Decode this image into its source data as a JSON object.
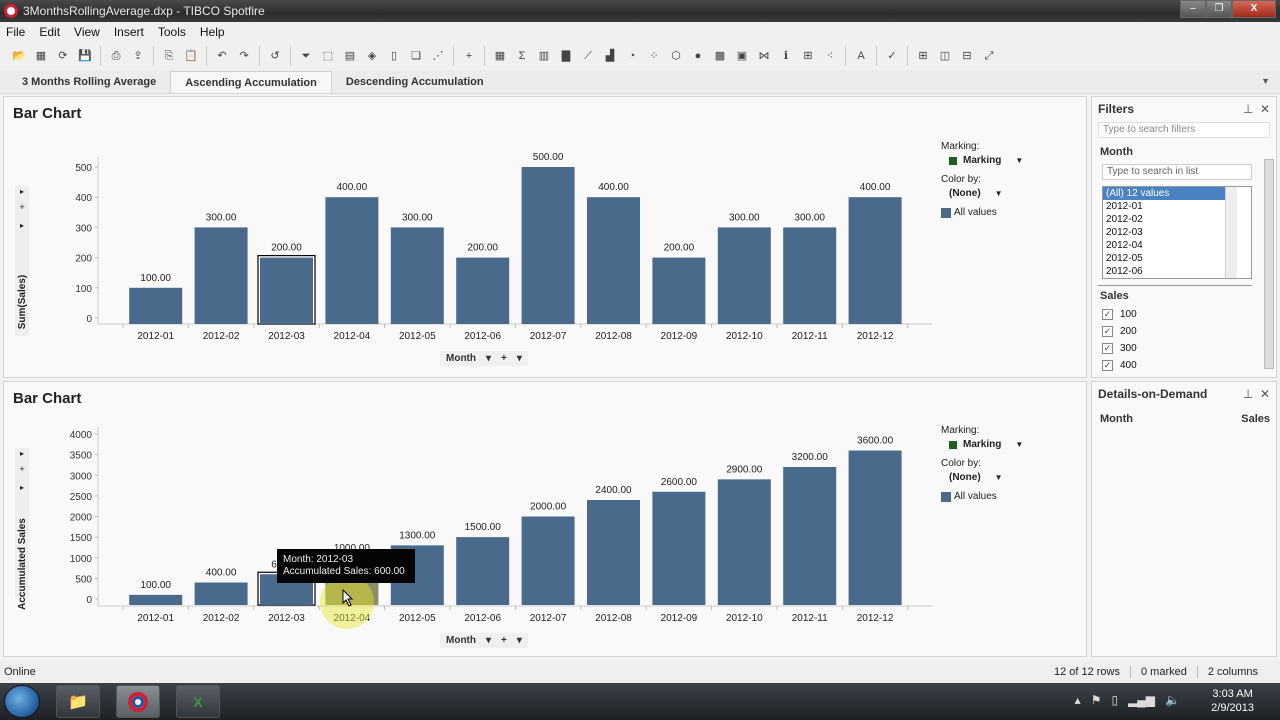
{
  "window": {
    "title": "3MonthsRollingAverage.dxp - TIBCO Spotfire",
    "minimize": "–",
    "maximize": "❐",
    "close": "X"
  },
  "menu": [
    "File",
    "Edit",
    "View",
    "Insert",
    "Tools",
    "Help"
  ],
  "toolbar": {
    "icons": [
      {
        "name": "open-icon",
        "glyph": "📂"
      },
      {
        "name": "add-data-icon",
        "glyph": "▦"
      },
      {
        "name": "reload-icon",
        "glyph": "⟳"
      },
      {
        "name": "save-icon",
        "glyph": "💾"
      },
      {
        "sep": true
      },
      {
        "name": "print-icon",
        "glyph": "⎙"
      },
      {
        "name": "export-icon",
        "glyph": "⇪"
      },
      {
        "sep": true
      },
      {
        "name": "copy-icon",
        "glyph": "⎘"
      },
      {
        "name": "paste-icon",
        "glyph": "📋"
      },
      {
        "sep": true
      },
      {
        "name": "undo-icon",
        "glyph": "↶"
      },
      {
        "name": "redo-icon",
        "glyph": "↷"
      },
      {
        "sep": true
      },
      {
        "name": "reset-icon",
        "glyph": "↺"
      },
      {
        "sep": true
      },
      {
        "name": "filter-icon",
        "glyph": "⏷"
      },
      {
        "name": "select-icon",
        "glyph": "⬚"
      },
      {
        "name": "details-icon",
        "glyph": "▤"
      },
      {
        "name": "tag-icon",
        "glyph": "◈"
      },
      {
        "name": "bookmark-icon",
        "glyph": "▯"
      },
      {
        "name": "lists-icon",
        "glyph": "❏"
      },
      {
        "name": "collaboration-icon",
        "glyph": "⋰"
      },
      {
        "sep": true
      },
      {
        "name": "new-page-icon",
        "glyph": "+"
      },
      {
        "sep": true
      },
      {
        "name": "table-icon",
        "glyph": "▦"
      },
      {
        "name": "cross-table-icon",
        "glyph": "Σ"
      },
      {
        "name": "graphical-table-icon",
        "glyph": "▥"
      },
      {
        "name": "bar-chart-icon",
        "glyph": "▇"
      },
      {
        "name": "line-chart-icon",
        "glyph": "⟋"
      },
      {
        "name": "combination-chart-icon",
        "glyph": "▟"
      },
      {
        "name": "pie-chart-icon",
        "glyph": "◔"
      },
      {
        "name": "scatter-plot-icon",
        "glyph": "⁘"
      },
      {
        "name": "3d-scatter-icon",
        "glyph": "⬡"
      },
      {
        "name": "map-chart-icon",
        "glyph": "●"
      },
      {
        "name": "treemap-icon",
        "glyph": "▩"
      },
      {
        "name": "heatmap-icon",
        "glyph": "▣"
      },
      {
        "name": "parallel-coordinates-icon",
        "glyph": "⋈"
      },
      {
        "name": "summary-table-icon",
        "glyph": "ℹ"
      },
      {
        "name": "box-plot-icon",
        "glyph": "⊞"
      },
      {
        "name": "network-icon",
        "glyph": "⁖"
      },
      {
        "sep": true
      },
      {
        "name": "text-area-icon",
        "glyph": "A"
      },
      {
        "sep": true
      },
      {
        "name": "kpi-icon",
        "glyph": "✓"
      },
      {
        "sep": true
      },
      {
        "name": "layout-grid-icon",
        "glyph": "⊞"
      },
      {
        "name": "layout-columns-icon",
        "glyph": "◫"
      },
      {
        "name": "layout-rows-icon",
        "glyph": "⊟"
      },
      {
        "name": "maximize-viz-icon",
        "glyph": "⤢"
      }
    ]
  },
  "tabs": [
    {
      "label": "3 Months Rolling Average",
      "active": false
    },
    {
      "label": "Ascending Accumulation",
      "active": true
    },
    {
      "label": "Descending Accumulation",
      "active": false
    }
  ],
  "tab_dropdown": "▼",
  "charts": {
    "top": {
      "title": "Bar Chart",
      "y_axis_label": "Sum(Sales)",
      "x_axis_selector": "Month",
      "legend": {
        "marking_label": "Marking:",
        "marking_value": "Marking",
        "marking_color": "#1f5d23",
        "color_by_label": "Color by:",
        "color_by_value": "(None)",
        "all_values": "All values",
        "bar_color": "#4a6a8c"
      }
    },
    "bottom": {
      "title": "Bar Chart",
      "y_axis_label": "Accumulated Sales",
      "x_axis_selector": "Month",
      "legend": {
        "marking_label": "Marking:",
        "marking_value": "Marking",
        "marking_color": "#1f5d23",
        "color_by_label": "Color by:",
        "color_by_value": "(None)",
        "all_values": "All values",
        "bar_color": "#4a6a8c"
      },
      "tooltip": {
        "line1": "Month: 2012-03",
        "line2": "Accumulated Sales: 600.00"
      }
    }
  },
  "chart_data": [
    {
      "type": "bar",
      "title": "Bar Chart",
      "xlabel": "Month",
      "ylabel": "Sum(Sales)",
      "categories": [
        "2012-01",
        "2012-02",
        "2012-03",
        "2012-04",
        "2012-05",
        "2012-06",
        "2012-07",
        "2012-08",
        "2012-09",
        "2012-10",
        "2012-11",
        "2012-12"
      ],
      "values": [
        100,
        300,
        200,
        400,
        300,
        200,
        500,
        400,
        200,
        300,
        300,
        400
      ],
      "data_labels": [
        "100.00",
        "300.00",
        "200.00",
        "400.00",
        "300.00",
        "200.00",
        "500.00",
        "400.00",
        "200.00",
        "300.00",
        "300.00",
        "400.00"
      ],
      "yticks": [
        0,
        100,
        200,
        300,
        400,
        500
      ],
      "ylim": [
        0,
        580
      ],
      "highlighted_index": 2,
      "color": "#4a6a8c",
      "legend": "right"
    },
    {
      "type": "bar",
      "title": "Bar Chart",
      "xlabel": "Month",
      "ylabel": "Accumulated Sales",
      "categories": [
        "2012-01",
        "2012-02",
        "2012-03",
        "2012-04",
        "2012-05",
        "2012-06",
        "2012-07",
        "2012-08",
        "2012-09",
        "2012-10",
        "2012-11",
        "2012-12"
      ],
      "values": [
        100,
        400,
        600,
        1000,
        1300,
        1500,
        2000,
        2400,
        2600,
        2900,
        3200,
        3600
      ],
      "data_labels": [
        "100.00",
        "400.00",
        "600.00",
        "1000.00",
        "1300.00",
        "1500.00",
        "2000.00",
        "2400.00",
        "2600.00",
        "2900.00",
        "3200.00",
        "3600.00"
      ],
      "yticks": [
        0,
        500,
        1000,
        1500,
        2000,
        2500,
        3000,
        3500,
        4000
      ],
      "ylim": [
        0,
        4000
      ],
      "highlighted_index": 2,
      "hovered_index": 3,
      "color": "#4a6a8c",
      "legend": "right"
    }
  ],
  "filters": {
    "title": "Filters",
    "search_placeholder": "Type to search filters",
    "month": {
      "label": "Month",
      "search_placeholder": "Type to search in list",
      "items": [
        "(All) 12 values",
        "2012-01",
        "2012-02",
        "2012-03",
        "2012-04",
        "2012-05",
        "2012-06"
      ]
    },
    "sales": {
      "label": "Sales",
      "items": [
        {
          "label": "100",
          "checked": true
        },
        {
          "label": "200",
          "checked": true
        },
        {
          "label": "300",
          "checked": true
        },
        {
          "label": "400",
          "checked": true
        }
      ]
    }
  },
  "details_on_demand": {
    "title": "Details-on-Demand",
    "col1": "Month",
    "col2": "Sales"
  },
  "status": {
    "online": "Online",
    "rows": "12 of 12 rows",
    "marked": "0 marked",
    "columns": "2 columns"
  },
  "taskbar": {
    "time": "3:03 AM",
    "date": "2/9/2013"
  }
}
